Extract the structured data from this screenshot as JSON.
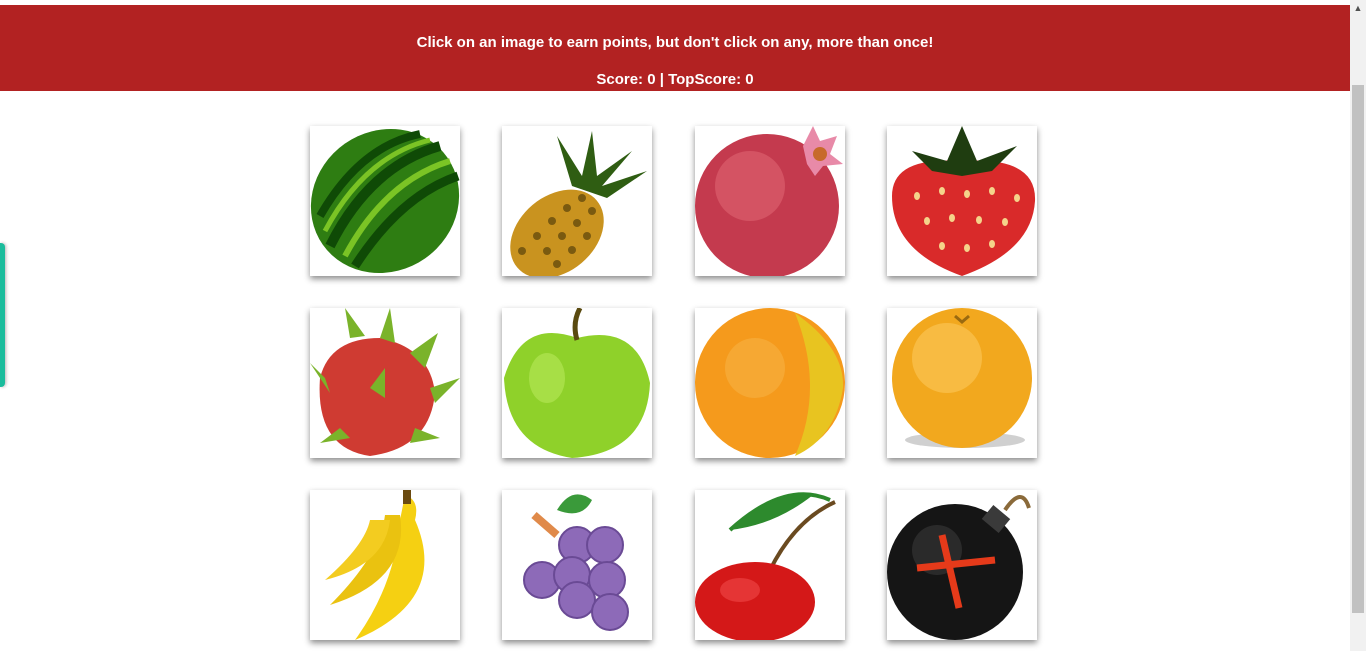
{
  "header": {
    "instructions": "Click on an image to earn points, but don't click on any, more than once!",
    "score_line": "Score: 0 | TopScore: 0",
    "background": "#b22222"
  },
  "cards": [
    {
      "icon": "watermelon-icon"
    },
    {
      "icon": "pineapple-icon"
    },
    {
      "icon": "pomegranate-icon"
    },
    {
      "icon": "strawberry-icon"
    },
    {
      "icon": "dragon-fruit-icon"
    },
    {
      "icon": "green-apple-icon"
    },
    {
      "icon": "orange-icon"
    },
    {
      "icon": "grapefruit-icon"
    },
    {
      "icon": "banana-icon"
    },
    {
      "icon": "grapes-icon"
    },
    {
      "icon": "cherry-icon"
    },
    {
      "icon": "bomb-icon"
    }
  ],
  "colors": {
    "side_tab": "#1abc9c"
  }
}
